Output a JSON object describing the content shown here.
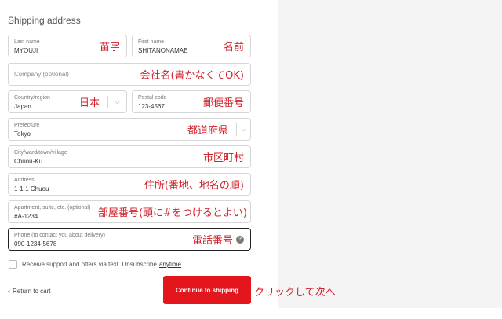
{
  "section_title": "Shipping address",
  "fields": {
    "last_name": {
      "label": "Last name",
      "value": "MYOUJI",
      "annotation": "苗字"
    },
    "first_name": {
      "label": "First name",
      "value": "SHITANONAMAE",
      "annotation": "名前"
    },
    "company": {
      "placeholder": "Company (optional)",
      "annotation": "会社名(書かなくてOK)"
    },
    "country": {
      "label": "Country/region",
      "value": "Japan",
      "annotation": "日本"
    },
    "postal_code": {
      "label": "Postal code",
      "value": "123-4567",
      "annotation": "郵便番号"
    },
    "prefecture": {
      "label": "Prefecture",
      "value": "Tokyo",
      "annotation": "都道府県"
    },
    "city": {
      "label": "City/ward/town/village",
      "value": "Chuou-Ku",
      "annotation": "市区町村"
    },
    "address": {
      "label": "Address",
      "value": "1-1-1 Chuou",
      "annotation": "住所(番地、地名の順)"
    },
    "apartment": {
      "label": "Apartment, suite, etc. (optional)",
      "value": "#A-1234",
      "annotation": "部屋番号(頭に#をつけるとよい)"
    },
    "phone": {
      "label": "Phone (to contact you about delivery)",
      "value": "090-1234-5678",
      "annotation": "電話番号",
      "help_icon": "?"
    }
  },
  "checkbox": {
    "text": "Receive support and offers via text. Unsubscribe",
    "link": "anytime",
    "suffix": "."
  },
  "return_link": {
    "chevron": "‹",
    "label": "Return to cart"
  },
  "continue_button": {
    "label": "Continue to shipping"
  },
  "click_annotation": "クリックして次へ",
  "colors": {
    "accent_red": "#e4161d",
    "annotation_red": "#d0202a"
  }
}
